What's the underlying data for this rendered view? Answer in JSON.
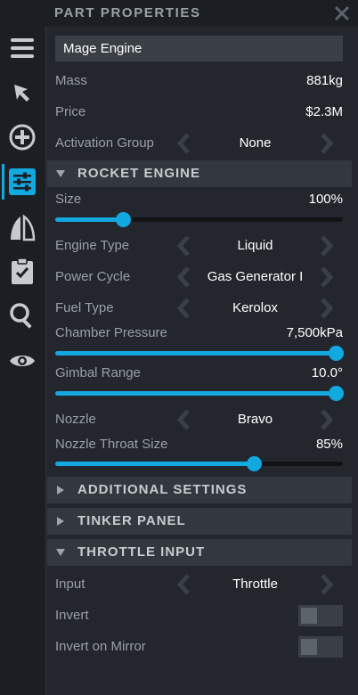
{
  "panel": {
    "title": "PART PROPERTIES"
  },
  "part": {
    "name": "Mage Engine",
    "mass_label": "Mass",
    "mass_value": "881kg",
    "price_label": "Price",
    "price_value": "$2.3M",
    "activation_label": "Activation Group",
    "activation_value": "None"
  },
  "rocket_engine": {
    "title": "ROCKET ENGINE",
    "size_label": "Size",
    "size_value": "100%",
    "size_fraction": 0.22,
    "engine_type_label": "Engine Type",
    "engine_type_value": "Liquid",
    "power_cycle_label": "Power Cycle",
    "power_cycle_value": "Gas Generator I",
    "fuel_type_label": "Fuel Type",
    "fuel_type_value": "Kerolox",
    "chamber_label": "Chamber Pressure",
    "chamber_value": "7,500kPa",
    "chamber_fraction": 1.0,
    "gimbal_label": "Gimbal Range",
    "gimbal_value": "10.0°",
    "gimbal_fraction": 1.0,
    "nozzle_label": "Nozzle",
    "nozzle_value": "Bravo",
    "throat_label": "Nozzle Throat Size",
    "throat_value": "85%",
    "throat_fraction": 0.7
  },
  "sections": {
    "additional": "ADDITIONAL SETTINGS",
    "tinker": "TINKER PANEL",
    "throttle": "THROTTLE INPUT"
  },
  "throttle": {
    "input_label": "Input",
    "input_value": "Throttle",
    "invert_label": "Invert",
    "invert_on": false,
    "mirror_label": "Invert on Mirror",
    "mirror_on": false
  },
  "sidebar_icons": [
    "menu-icon",
    "cursor-icon",
    "add-part-icon",
    "part-properties-icon",
    "symmetry-icon",
    "checklist-icon",
    "search-icon",
    "visibility-icon"
  ],
  "colors": {
    "accent": "#12a8e0",
    "background": "#23272d",
    "sidebar": "#1b1e22"
  }
}
